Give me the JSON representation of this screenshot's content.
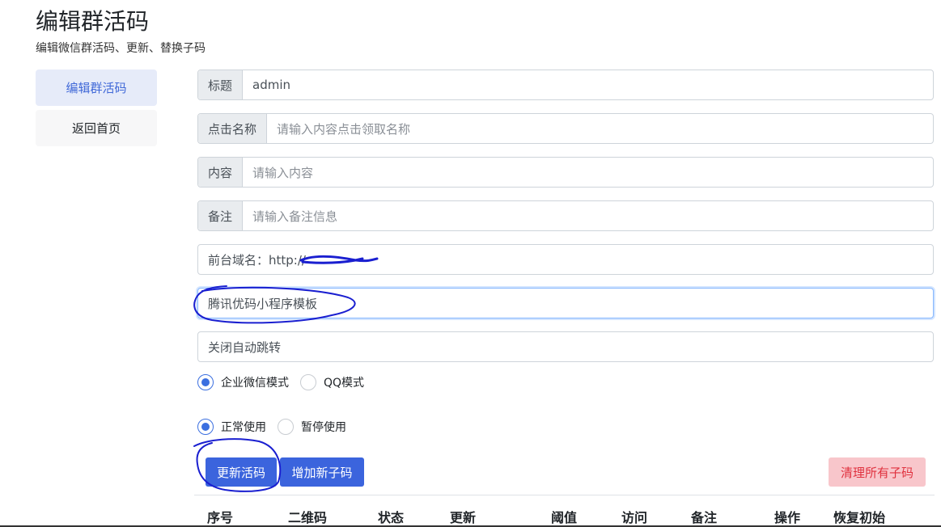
{
  "header": {
    "title": "编辑群活码",
    "subtitle": "编辑微信群活码、更新、替换子码"
  },
  "sidebar": {
    "items": [
      {
        "label": "编辑群活码",
        "active": true
      },
      {
        "label": "返回首页",
        "active": false
      }
    ]
  },
  "form": {
    "title_label": "标题",
    "title_value": "admin",
    "click_name_label": "点击名称",
    "click_name_placeholder": "请输入内容点击领取名称",
    "content_label": "内容",
    "content_placeholder": "请输入内容",
    "note_label": "备注",
    "note_placeholder": "请输入备注信息",
    "domain_text": "前台域名：http://",
    "template_value": "腾讯优码小程序模板",
    "redirect_value": "关闭自动跳转"
  },
  "mode_radios": [
    {
      "label": "企业微信模式",
      "checked": true
    },
    {
      "label": "QQ模式",
      "checked": false
    }
  ],
  "status_radios": [
    {
      "label": "正常使用",
      "checked": true
    },
    {
      "label": "暂停使用",
      "checked": false
    }
  ],
  "buttons": {
    "update": "更新活码",
    "add_sub": "增加新子码",
    "clear_all": "清理所有子码"
  },
  "table": {
    "headers": [
      "序号",
      "二维码",
      "状态",
      "更新",
      "阈值",
      "访问",
      "备注",
      "操作",
      "恢复初始"
    ]
  },
  "colors": {
    "primary": "#3b64dd",
    "danger_bg": "#f8c6cb",
    "danger_text": "#e0323f",
    "sidebar_active_bg": "#e6ebf9",
    "sidebar_active_text": "#4169d8",
    "annotation_ink": "#1a1fd0"
  }
}
